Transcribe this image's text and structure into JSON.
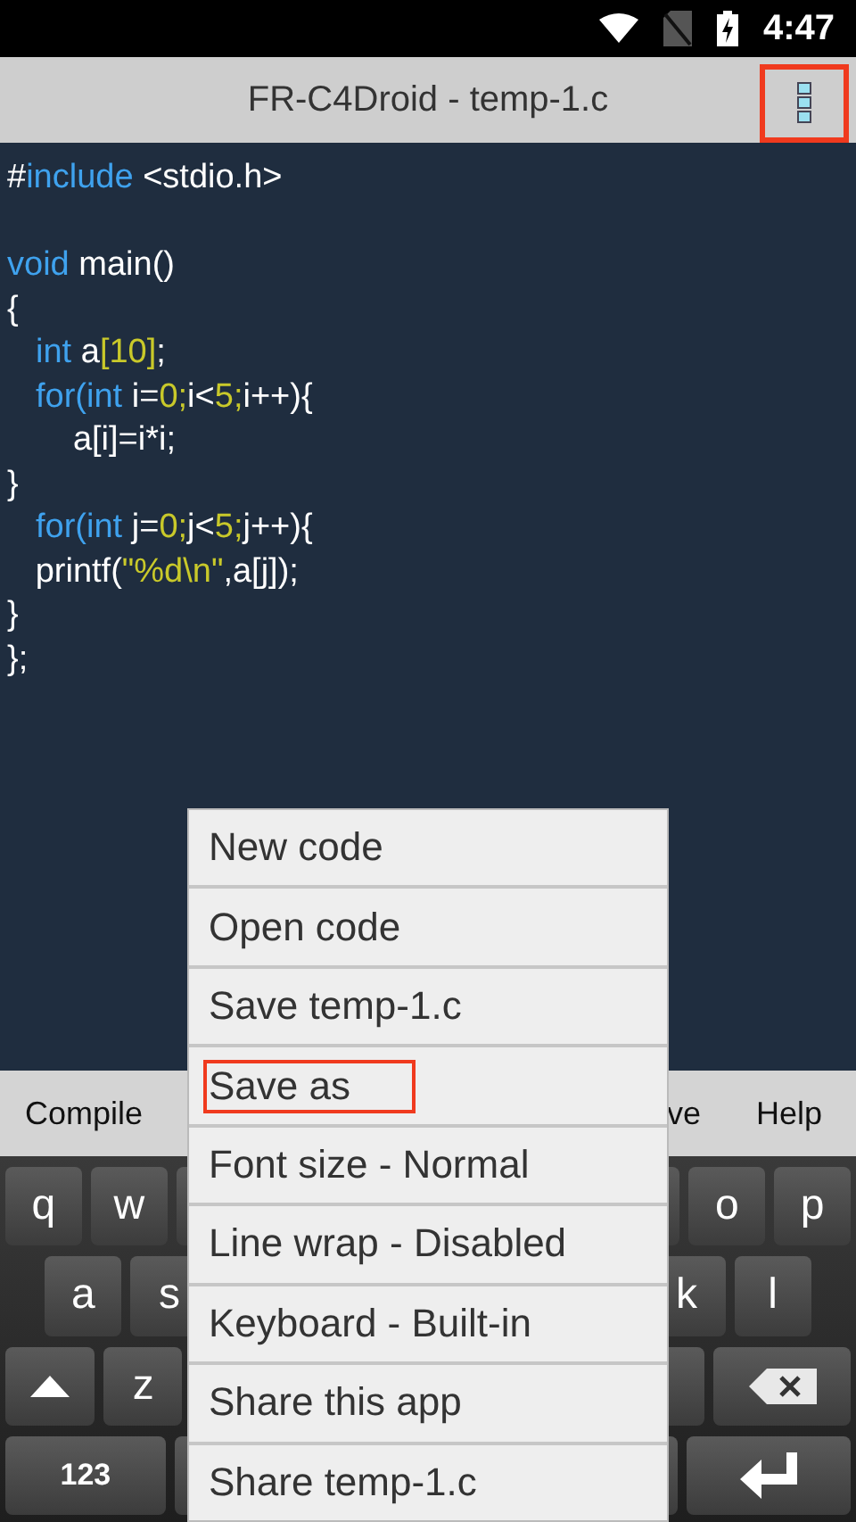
{
  "status_bar": {
    "time": "4:47"
  },
  "title_bar": {
    "title": "FR-C4Droid - temp-1.c",
    "menu_button": {
      "highlighted": true
    }
  },
  "editor": {
    "lines": [
      {
        "kind": "code",
        "tokens": [
          {
            "kind": "plain",
            "text": "#"
          },
          {
            "kind": "keyword",
            "text": "include"
          },
          {
            "kind": "plain",
            "text": " <stdio.h>"
          }
        ]
      },
      {
        "kind": "blank"
      },
      {
        "kind": "code",
        "tokens": [
          {
            "kind": "keyword",
            "text": "void"
          },
          {
            "kind": "plain",
            "text": " main()"
          }
        ]
      },
      {
        "kind": "code",
        "tokens": [
          {
            "kind": "plain",
            "text": "{"
          }
        ]
      },
      {
        "kind": "code",
        "nested": true,
        "tokens": [
          {
            "kind": "keyword",
            "text": "int"
          },
          {
            "kind": "plain",
            "text": " a"
          },
          {
            "kind": "number",
            "text": "[10]"
          },
          {
            "kind": "plain",
            "text": ";"
          }
        ]
      },
      {
        "kind": "code",
        "nested": true,
        "tokens": [
          {
            "kind": "keyword",
            "text": "for(int"
          },
          {
            "kind": "plain",
            "text": " i="
          },
          {
            "kind": "number",
            "text": "0;"
          },
          {
            "kind": "plain",
            "text": "i<"
          },
          {
            "kind": "number",
            "text": "5;"
          },
          {
            "kind": "plain",
            "text": "i++){"
          }
        ]
      },
      {
        "kind": "code",
        "tokens": [
          {
            "kind": "plain",
            "text": "       a[i]=i*i;"
          }
        ]
      },
      {
        "kind": "code",
        "tokens": [
          {
            "kind": "plain",
            "text": "}"
          }
        ]
      },
      {
        "kind": "code",
        "nested": true,
        "tokens": [
          {
            "kind": "keyword",
            "text": "for(int"
          },
          {
            "kind": "plain",
            "text": " j="
          },
          {
            "kind": "number",
            "text": "0;"
          },
          {
            "kind": "plain",
            "text": "j<"
          },
          {
            "kind": "number",
            "text": "5;"
          },
          {
            "kind": "plain",
            "text": "j++){"
          }
        ]
      },
      {
        "kind": "code",
        "tokens": [
          {
            "kind": "plain",
            "text": "   printf("
          },
          {
            "kind": "number",
            "text": "\"%d\\n\""
          },
          {
            "kind": "plain",
            "text": ",a[j]);"
          }
        ]
      },
      {
        "kind": "code",
        "tokens": [
          {
            "kind": "plain",
            "text": "}"
          }
        ]
      },
      {
        "kind": "code",
        "tokens": [
          {
            "kind": "plain",
            "text": "};"
          }
        ]
      }
    ]
  },
  "toolbar": {
    "left": [
      "Compile"
    ],
    "right": [
      "ve",
      "Help"
    ]
  },
  "keyboard": {
    "rows": [
      [
        {
          "kind": "letter",
          "label": "q"
        },
        {
          "kind": "letter",
          "label": "w"
        },
        {
          "kind": "letter"
        },
        {
          "kind": "covered"
        },
        {
          "kind": "covered"
        },
        {
          "kind": "covered"
        },
        {
          "kind": "covered"
        },
        {
          "kind": "letter"
        },
        {
          "kind": "letter",
          "label": "o"
        },
        {
          "kind": "letter",
          "label": "p"
        }
      ],
      [
        {
          "kind": "letter",
          "label": "a"
        },
        {
          "kind": "letter",
          "label": "s"
        },
        {
          "kind": "covered"
        },
        {
          "kind": "covered"
        },
        {
          "kind": "covered"
        },
        {
          "kind": "covered"
        },
        {
          "kind": "covered"
        },
        {
          "kind": "letter",
          "label": "k"
        },
        {
          "kind": "letter",
          "label": "l"
        }
      ],
      [
        {
          "kind": "shift"
        },
        {
          "kind": "letter",
          "label": "z"
        },
        {
          "kind": "covered"
        },
        {
          "kind": "covered"
        },
        {
          "kind": "covered"
        },
        {
          "kind": "covered"
        },
        {
          "kind": "covered"
        },
        {
          "kind": "letter"
        },
        {
          "kind": "backspace"
        }
      ],
      [
        {
          "kind": "mode",
          "label": "123"
        },
        {
          "kind": "letter"
        },
        {
          "kind": "covered_wide"
        },
        {
          "kind": "letter"
        },
        {
          "kind": "enter"
        }
      ]
    ]
  },
  "menu": {
    "items": [
      {
        "label": "New code",
        "highlighted": false
      },
      {
        "label": "Open code",
        "highlighted": false
      },
      {
        "label": "Save temp-1.c",
        "highlighted": false
      },
      {
        "label": "Save as",
        "highlighted": true
      },
      {
        "label": "Font size - Normal",
        "highlighted": false
      },
      {
        "label": "Line wrap - Disabled",
        "highlighted": false
      },
      {
        "label": "Keyboard - Built-in",
        "highlighted": false
      },
      {
        "label": "Share this app",
        "highlighted": false
      },
      {
        "label": "Share temp-1.c",
        "highlighted": false
      }
    ]
  }
}
